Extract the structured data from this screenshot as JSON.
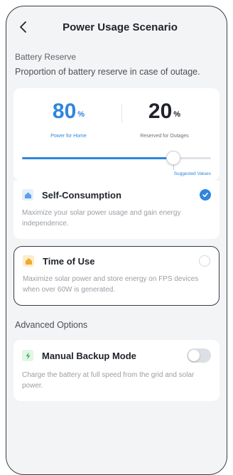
{
  "header": {
    "title": "Power Usage Scenario",
    "back_icon": "chevron-left-icon"
  },
  "battery_reserve": {
    "section_title": "Battery Reserve",
    "description": "Proportion of battery reserve in case of outage.",
    "power_value": "80",
    "power_unit": "%",
    "power_caption": "Power for Home",
    "reserved_value": "20",
    "reserved_unit": "%",
    "reserved_caption": "Reserved for Outages",
    "slider_level_percent": 80,
    "suggested_label": "Suggested Values"
  },
  "modes": [
    {
      "label": "Self-Consumption",
      "description": "Maximize your solar power usage and gain energy independence.",
      "icon": "home-icon",
      "selected": true
    },
    {
      "label": "Time of Use",
      "description": "Maximize solar power and store energy on FPS devices when over 60W is generated.",
      "icon": "battery-icon",
      "selected": false
    }
  ],
  "advanced": {
    "section_title": "Advanced Options",
    "manual_backup": {
      "label": "Manual Backup Mode",
      "description": "Charge the battery at full speed from the grid and solar power.",
      "icon": "lightning-icon",
      "enabled": false
    }
  },
  "colors": {
    "accent": "#2e86de",
    "background": "#f3f4f6",
    "card": "#ffffff"
  }
}
